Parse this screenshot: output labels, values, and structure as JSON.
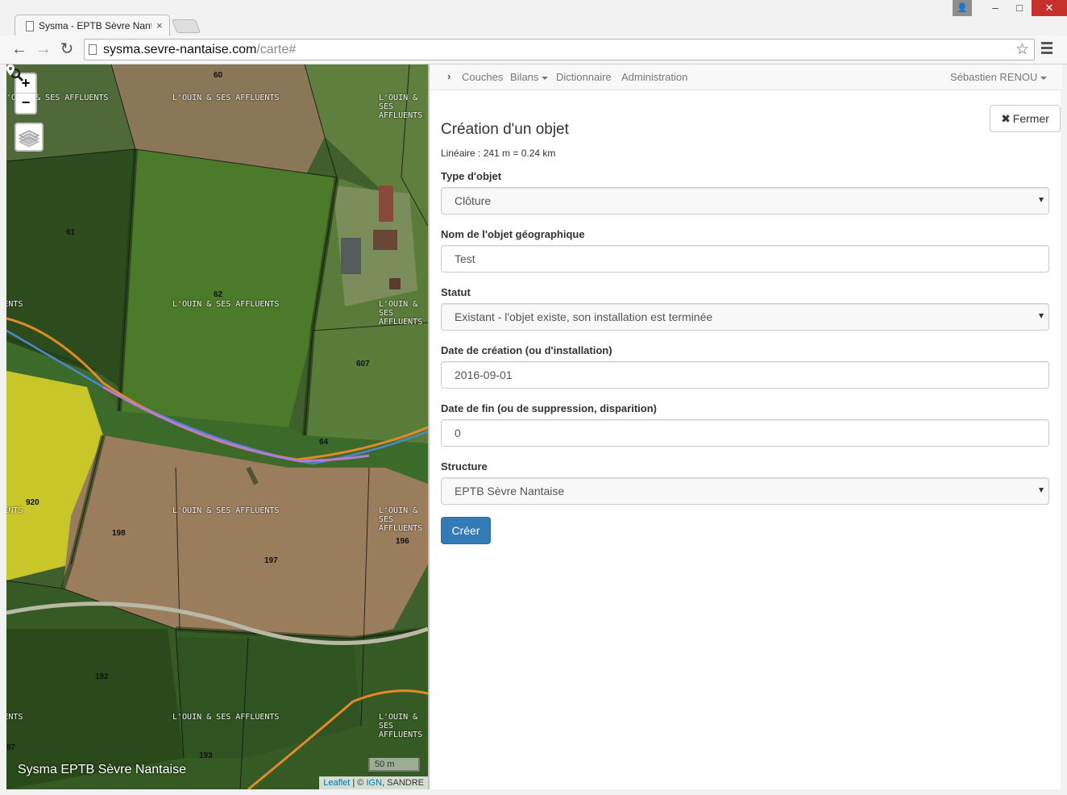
{
  "browser": {
    "tab_title": "Sysma - EPTB Sèvre Nantaise",
    "url_host": "sysma.sevre-nantaise.com",
    "url_path": "/carte#",
    "close_glyph": "×",
    "back_glyph": "←",
    "forward_glyph": "→",
    "reload_glyph": "↻",
    "star_glyph": "☆",
    "window": {
      "user_glyph": "👤",
      "minimize": "–",
      "maximize": "□",
      "close": "✕"
    }
  },
  "map": {
    "zoom_in": "+",
    "zoom_out": "−",
    "brand": "Sysma EPTB Sèvre Nantaise",
    "scale": "50 m",
    "attribution": {
      "leaflet": "Leaflet",
      "sep": " | © ",
      "ign": "IGN",
      "rest": ", SANDRE"
    },
    "zone_labels": [
      "L'OUIN & SES AFFLUENTS",
      "L'OUIN & SES AFFLUENTS",
      "L'OUIN & SES AFFLUENTS",
      "L'OUIN & SES AFFLUENTS",
      "L'OUIN & SES AFFLUENTS",
      "L'OUIN & SES AFFLUENTS",
      "L'OUIN & SES AFFLUENTS",
      "L'OUIN & SES AFFLUENTS",
      "L'OUIN & SES AFFLUENTS",
      "L'OUIN & SES AFFLUENTS",
      "L'OUIN & SES AFFLUENTS",
      "L'OUIN & SES AFFLUENTS"
    ],
    "parcels": [
      "60",
      "61",
      "62",
      "607",
      "64",
      "920",
      "198",
      "197",
      "196",
      "192",
      "193",
      "87"
    ],
    "colors": {
      "river": "#4a86c8",
      "route": "#e08a2a",
      "drawn": "#b57ad6"
    }
  },
  "navbar": {
    "chevron": "›",
    "couches": "Couches",
    "bilans": "Bilans",
    "dictionnaire": "Dictionnaire",
    "administration": "Administration",
    "user": "Sébastien RENOU"
  },
  "form": {
    "close_icon": "✖",
    "close_label": "Fermer",
    "title": "Création d'un objet",
    "lineaire": "Linéaire : 241 m = 0.24 km",
    "type_label": "Type d'objet",
    "type_value": "Clôture",
    "nom_label": "Nom de l'objet géographique",
    "nom_value": "Test",
    "statut_label": "Statut",
    "statut_value": "Existant - l'objet existe, son installation est terminée",
    "date_creation_label": "Date de création (ou d'installation)",
    "date_creation_value": "2016-09-01",
    "date_fin_label": "Date de fin (ou de suppression, disparition)",
    "date_fin_value": "0",
    "structure_label": "Structure",
    "structure_value": "EPTB Sèvre Nantaise",
    "submit_label": "Créer",
    "accent_color": "#337ab7"
  }
}
